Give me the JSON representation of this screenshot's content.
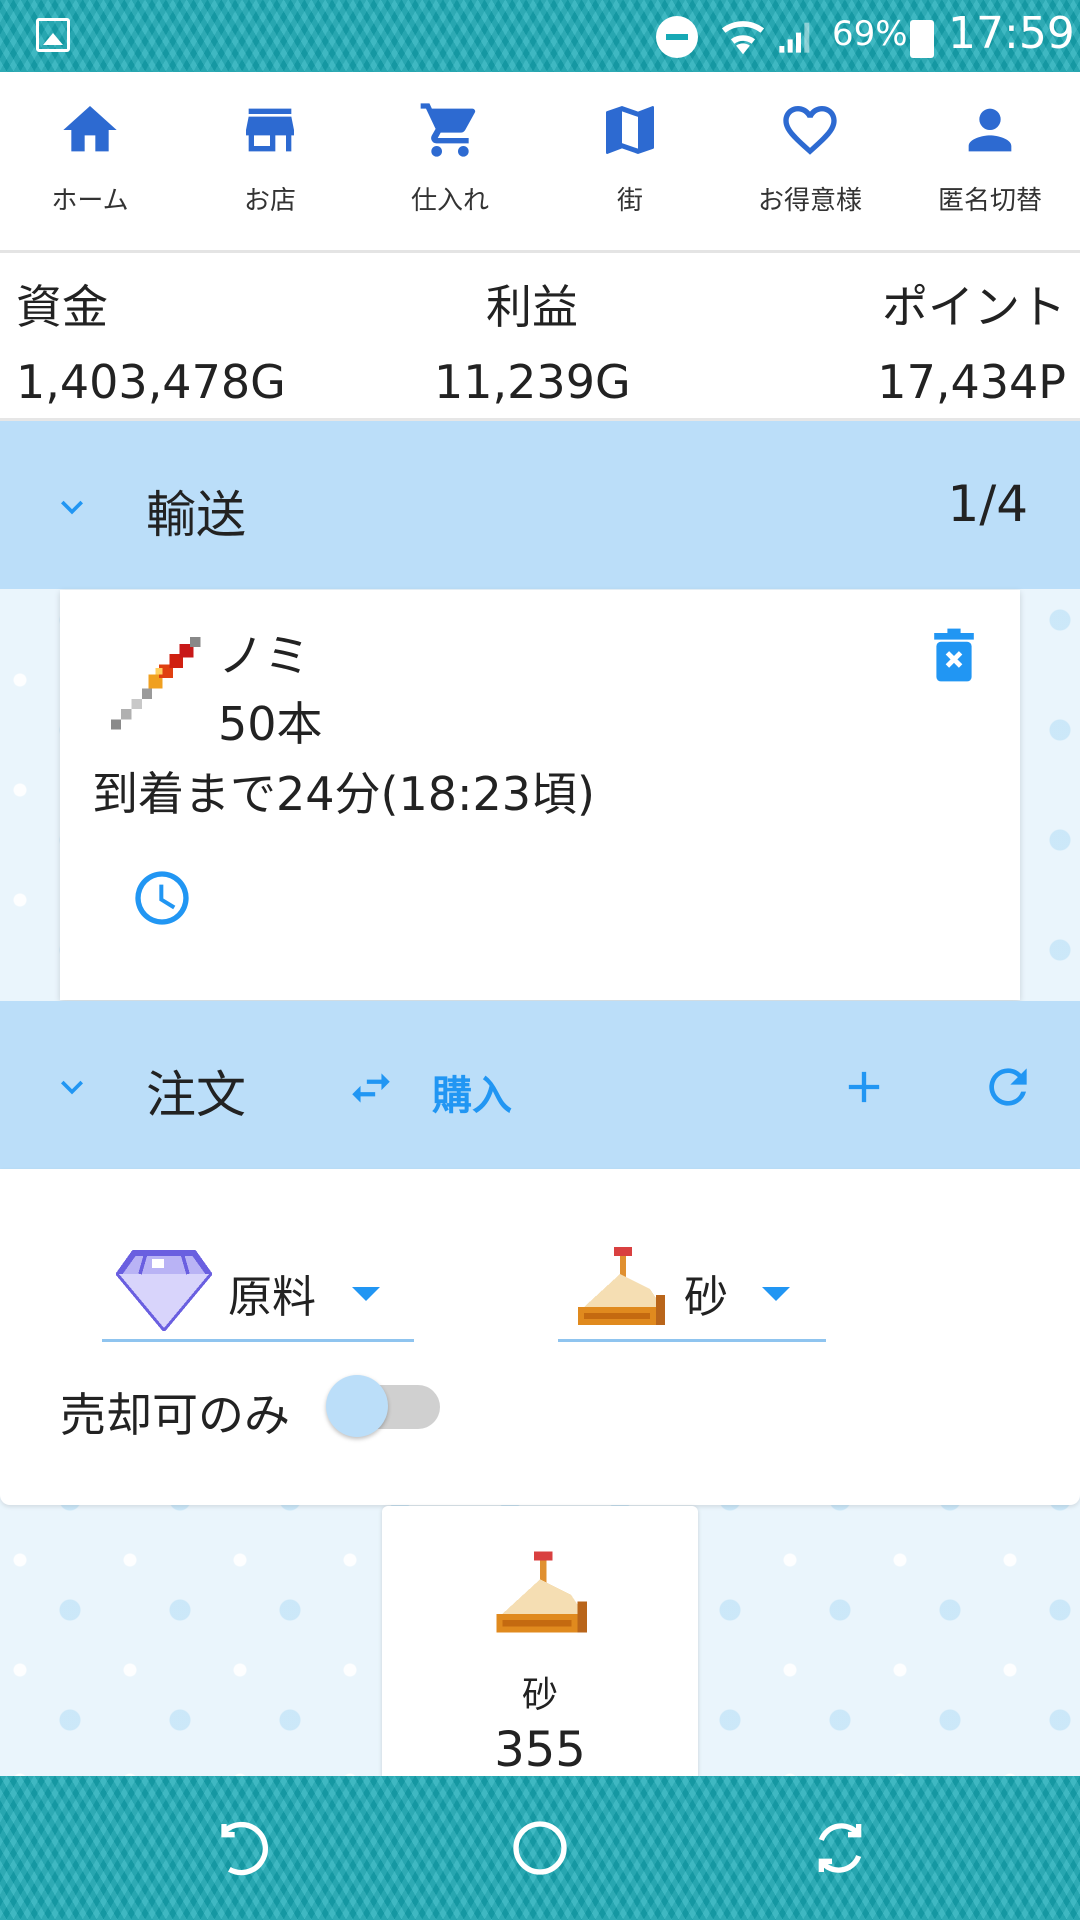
{
  "status_bar": {
    "battery": "69%",
    "time": "17:59",
    "icons": [
      "gallery-icon",
      "do-not-disturb-icon",
      "wifi-icon",
      "signal-icon",
      "battery-icon"
    ]
  },
  "nav": {
    "items": [
      {
        "label": "ホーム",
        "icon": "home-icon"
      },
      {
        "label": "お店",
        "icon": "store-icon"
      },
      {
        "label": "仕入れ",
        "icon": "cart-icon"
      },
      {
        "label": "街",
        "icon": "map-icon"
      },
      {
        "label": "お得意様",
        "icon": "heart-icon"
      },
      {
        "label": "匿名切替",
        "icon": "person-icon"
      }
    ],
    "accent": "#2d6ad1"
  },
  "stats": {
    "funds": {
      "label": "資金",
      "value": "1,403,478G"
    },
    "profit": {
      "label": "利益",
      "value": "11,239G"
    },
    "points": {
      "label": "ポイント",
      "value": "17,434P"
    }
  },
  "transport": {
    "title": "輸送",
    "count": "1/4",
    "item": {
      "name": "ノミ",
      "quantity": "50本",
      "eta": "到着まで24分(18:23頃)",
      "icon": "chisel-icon"
    }
  },
  "order": {
    "title": "注文",
    "mode_label": "購入",
    "accent": "#2196f3"
  },
  "filters": {
    "category": {
      "value": "原料",
      "icon": "gem-icon"
    },
    "item": {
      "value": "砂",
      "icon": "sand-icon"
    },
    "sellable_only_label": "売却可のみ",
    "sellable_only": false
  },
  "results": [
    {
      "name": "砂",
      "value": "355",
      "icon": "sand-icon"
    }
  ],
  "system_nav": [
    "back-icon",
    "home-circle-icon",
    "recents-icon"
  ]
}
